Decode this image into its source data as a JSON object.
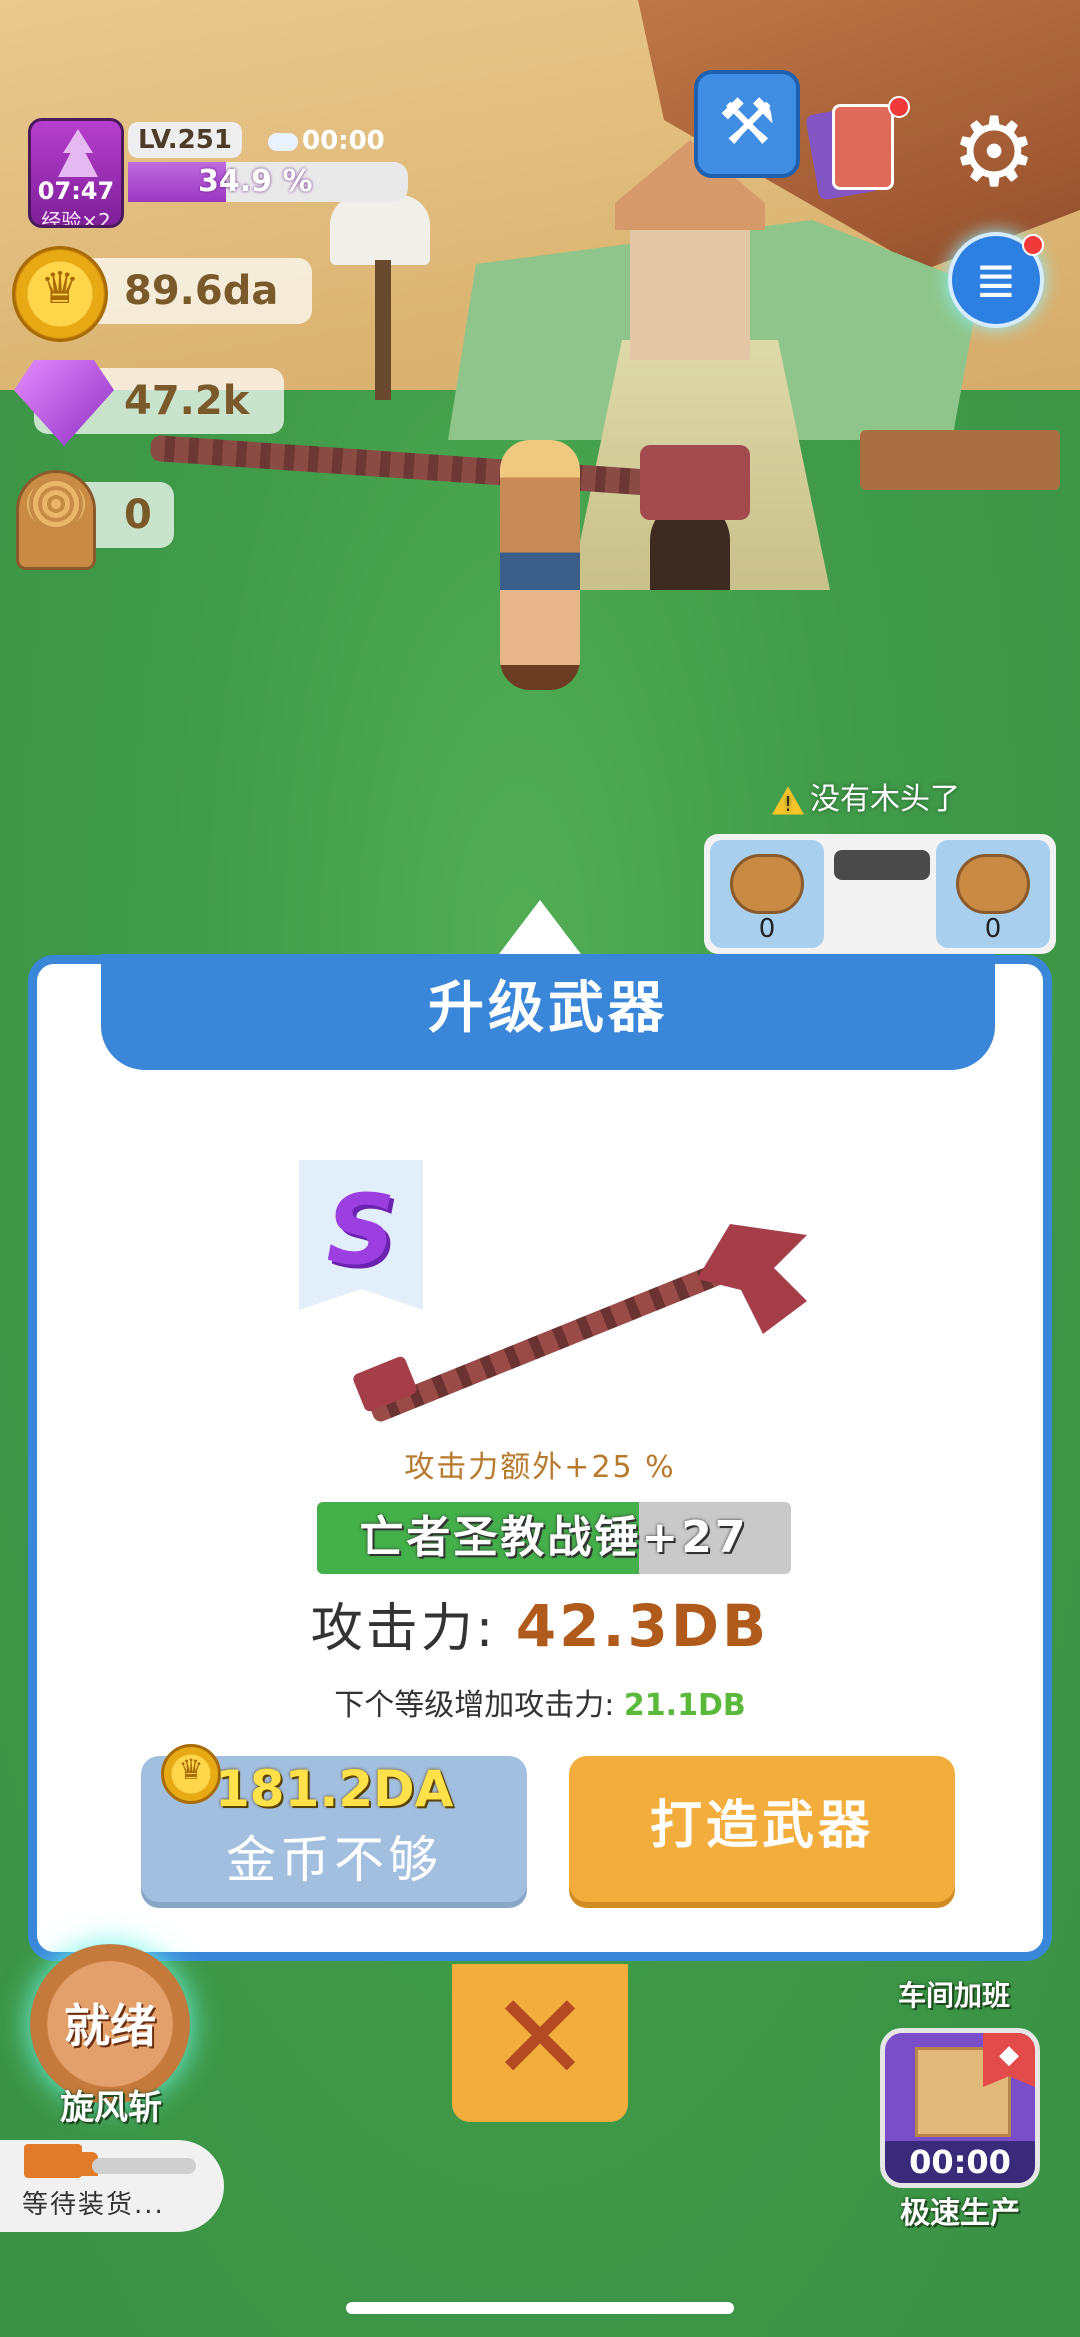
{
  "hud": {
    "avatar_timer": "07:47",
    "exp_bonus": "经验×2",
    "level": "LV.251",
    "weather_timer": "00:00",
    "xp_percent_text": "34.9 %",
    "xp_fraction": 0.349,
    "coins": "89.6da",
    "gems": "47.2k",
    "wood": "0"
  },
  "top_right": {
    "hammer_icon": "hammer-icon",
    "cards_icon": "cards-icon",
    "settings_icon": "gear-icon",
    "quest_icon": "quest-list-icon"
  },
  "warning": {
    "text": "没有木头了",
    "icon": "warning-icon"
  },
  "processing": {
    "input_count": "0",
    "output_count": "0"
  },
  "modal": {
    "title": "升级武器",
    "rank": "S",
    "bonus": "攻击力额外+25 %",
    "weapon_name": "亡者圣教战锤+27",
    "weapon_progress": 0.68,
    "attack_label": "攻击力:",
    "attack_value": "42.3DB",
    "next_label": "下个等级增加攻击力:",
    "next_value": "21.1DB",
    "cost": "181.2DA",
    "insufficient_label": "金币不够",
    "forge_label": "打造武器",
    "close_icon": "close-icon"
  },
  "bottom": {
    "skill_status": "就绪",
    "skill_name": "旋风斩",
    "truck_status": "等待装货...",
    "overtime_label": "车间加班",
    "speed_timer": "00:00",
    "speed_label": "极速生产"
  },
  "colors": {
    "modal_blue": "#3a86d8",
    "forge_orange": "#f2ad3c",
    "progress_green": "#44b04a",
    "attack_brown": "#b05a1c",
    "next_green": "#5ab83a"
  }
}
